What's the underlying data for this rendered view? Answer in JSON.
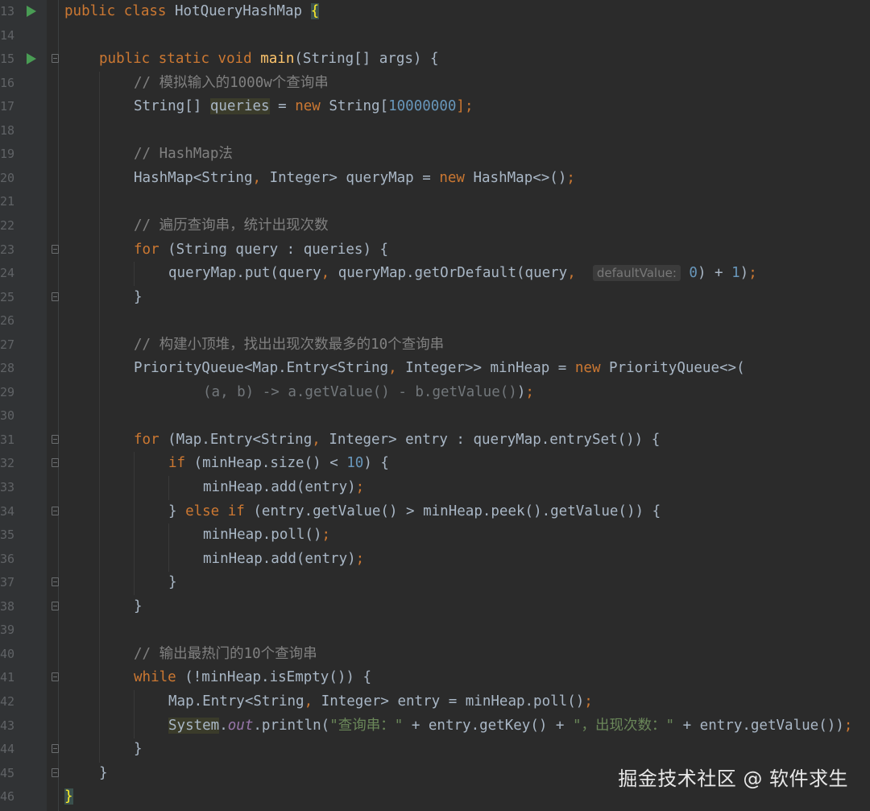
{
  "editor": {
    "lines": [
      {
        "num": "13",
        "run": true,
        "fold": false
      },
      {
        "num": "14",
        "run": false,
        "fold": false
      },
      {
        "num": "15",
        "run": true,
        "fold": true
      },
      {
        "num": "16",
        "run": false,
        "fold": false
      },
      {
        "num": "17",
        "run": false,
        "fold": false
      },
      {
        "num": "18",
        "run": false,
        "fold": false
      },
      {
        "num": "19",
        "run": false,
        "fold": false
      },
      {
        "num": "20",
        "run": false,
        "fold": false
      },
      {
        "num": "21",
        "run": false,
        "fold": false
      },
      {
        "num": "22",
        "run": false,
        "fold": false
      },
      {
        "num": "23",
        "run": false,
        "fold": true
      },
      {
        "num": "24",
        "run": false,
        "fold": false
      },
      {
        "num": "25",
        "run": false,
        "fold": true
      },
      {
        "num": "26",
        "run": false,
        "fold": false
      },
      {
        "num": "27",
        "run": false,
        "fold": false
      },
      {
        "num": "28",
        "run": false,
        "fold": false
      },
      {
        "num": "29",
        "run": false,
        "fold": false
      },
      {
        "num": "30",
        "run": false,
        "fold": false
      },
      {
        "num": "31",
        "run": false,
        "fold": true
      },
      {
        "num": "32",
        "run": false,
        "fold": true
      },
      {
        "num": "33",
        "run": false,
        "fold": false
      },
      {
        "num": "34",
        "run": false,
        "fold": true
      },
      {
        "num": "35",
        "run": false,
        "fold": false
      },
      {
        "num": "36",
        "run": false,
        "fold": false
      },
      {
        "num": "37",
        "run": false,
        "fold": true
      },
      {
        "num": "38",
        "run": false,
        "fold": true
      },
      {
        "num": "39",
        "run": false,
        "fold": false
      },
      {
        "num": "40",
        "run": false,
        "fold": false
      },
      {
        "num": "41",
        "run": false,
        "fold": true
      },
      {
        "num": "42",
        "run": false,
        "fold": false
      },
      {
        "num": "43",
        "run": false,
        "fold": false
      },
      {
        "num": "44",
        "run": false,
        "fold": true
      },
      {
        "num": "45",
        "run": false,
        "fold": true
      },
      {
        "num": "46",
        "run": false,
        "fold": false
      }
    ],
    "tokens": {
      "l13": [
        "public",
        "class",
        "HotQueryHashMap",
        "{"
      ],
      "l15": [
        "public",
        "static",
        "void",
        "main",
        "(String[] args) {"
      ],
      "l16": "// 模拟输入的1000w个查询串",
      "l17": [
        "String[] ",
        "queries",
        " = ",
        "new",
        " String[",
        "10000000",
        "];"
      ],
      "l19": "// HashMap法",
      "l20": [
        "HashMap<String",
        ",",
        " Integer> queryMap = ",
        "new",
        " HashMap<>()",
        ";"
      ],
      "l22": "// 遍历查询串，统计出现次数",
      "l23": [
        "for",
        " (String query : queries) {"
      ],
      "l24": [
        "queryMap.put(query",
        ",",
        " queryMap.getOrDefault(query",
        ",",
        "defaultValue:",
        "0",
        ") + ",
        "1",
        ")",
        ";"
      ],
      "l25": "}",
      "l27": "// 构建小顶堆，找出出现次数最多的10个查询串",
      "l28": [
        "PriorityQueue<Map.Entry<String",
        ",",
        " Integer>> minHeap = ",
        "new",
        " PriorityQueue<>("
      ],
      "l29": [
        "(a, b) -> a.getValue() - b.getValue()",
        ")",
        ";"
      ],
      "l31": [
        "for",
        " (Map.Entry<String",
        ",",
        " Integer> entry : queryMap.entrySet()) {"
      ],
      "l32": [
        "if",
        " (minHeap.size() < ",
        "10",
        ") {"
      ],
      "l33": [
        "minHeap.add(entry)",
        ";"
      ],
      "l34": [
        "} ",
        "else if",
        " (entry.getValue() > minHeap.peek().getValue()) {"
      ],
      "l35": [
        "minHeap.poll()",
        ";"
      ],
      "l36": [
        "minHeap.add(entry)",
        ";"
      ],
      "l37": "}",
      "l38": "}",
      "l40": "// 输出最热门的10个查询串",
      "l41": [
        "while",
        " (!minHeap.isEmpty()) {"
      ],
      "l42": [
        "Map.Entry<String",
        ",",
        " Integer> entry = minHeap.poll()",
        ";"
      ],
      "l43": [
        "System",
        ".",
        "out",
        ".println(",
        "\"查询串：\"",
        " + entry.getKey() + ",
        "\"，出现次数：\"",
        " + entry.getValue())",
        ";"
      ],
      "l44": "}",
      "l45": "}",
      "l46": "}"
    }
  },
  "watermark": "掘金技术社区 @ 软件求生",
  "colors": {
    "background": "#2b2b2b",
    "keyword": "#cc7832",
    "method_decl": "#ffc66d",
    "number": "#6897bb",
    "string": "#6a8759",
    "comment": "#808080",
    "default_text": "#a9b7c6"
  }
}
